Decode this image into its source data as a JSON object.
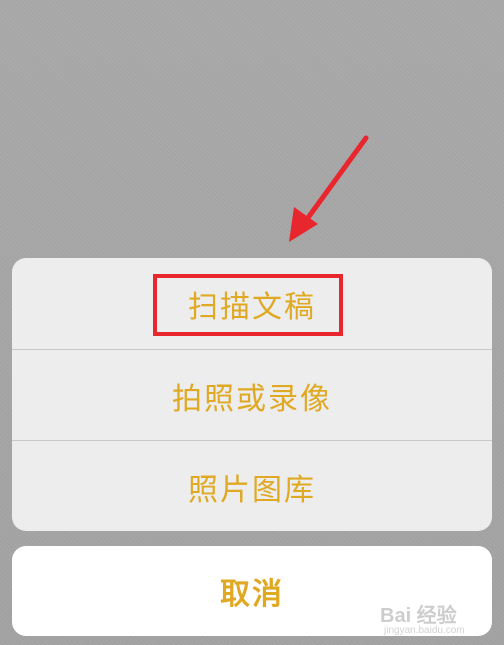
{
  "action_sheet": {
    "options": [
      {
        "label": "扫描文稿"
      },
      {
        "label": "拍照或录像"
      },
      {
        "label": "照片图库"
      }
    ],
    "cancel_label": "取消"
  },
  "watermark": {
    "text": "Bai 经验",
    "sub": "jingyan.baidu.com"
  },
  "colors": {
    "accent": "#e0a924",
    "annotation": "#e8262d"
  }
}
